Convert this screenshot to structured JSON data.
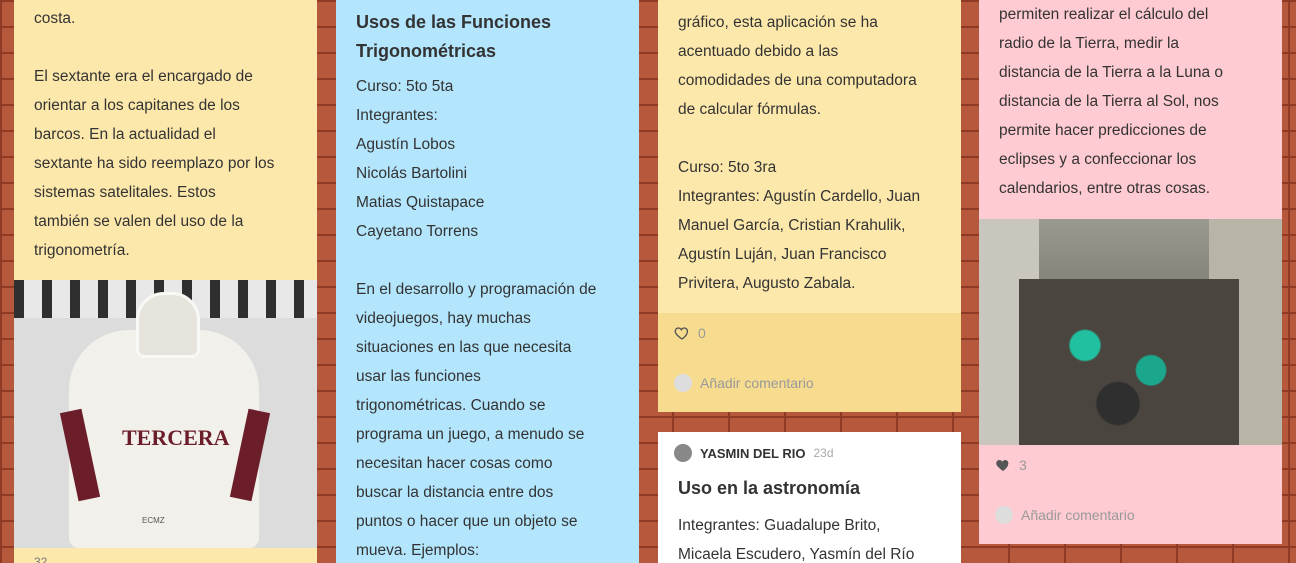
{
  "cards": {
    "c1": {
      "lines": [
        "costa.",
        "",
        "El sextante era el encargado de",
        "orientar a los capitanes de los",
        "barcos. En la actualidad el",
        "sextante ha sido reemplazo por los",
        "sistemas satelitales. Estos",
        "también se valen del uso de la",
        "trigonometría."
      ],
      "image_text": "TERCERA",
      "image_small_text": "ECMZ",
      "bottom_cut": "32"
    },
    "c2": {
      "title_l1": "Usos de las Funciones",
      "title_l2": "Trigonométricas",
      "lines": [
        "Curso: 5to 5ta",
        "Integrantes:",
        "Agustín Lobos",
        "Nicolás Bartolini",
        "Matias Quistapace",
        "Cayetano Torrens",
        "",
        "En el desarrollo y programación de",
        "videojuegos, hay muchas",
        "situaciones en las que necesita",
        "usar las funciones",
        "trigonométricas. Cuando se",
        "programa un juego, a menudo se",
        "necesitan hacer cosas como",
        "buscar la distancia entre dos",
        "puntos o hacer que un objeto se",
        "mueva.  Ejemplos:"
      ]
    },
    "c3": {
      "lines": [
        "gráfico, esta aplicación se ha",
        "acentuado debido a las",
        "comodidades de una computadora",
        "de calcular fórmulas.",
        "",
        "Curso: 5to 3ra",
        "Integrantes: Agustín Cardello, Juan",
        "Manuel García, Cristian Krahulik,",
        "Agustín Luján, Juan Francisco",
        "Privitera, Augusto Zabala."
      ],
      "likes": "0",
      "comment_placeholder": "Añadir comentario"
    },
    "c4": {
      "author": "YASMIN DEL RIO",
      "age": "23d",
      "title": "Uso en la astronomía",
      "lines": [
        "Integrantes: Guadalupe Brito,",
        "Micaela Escudero, Yasmín del Río"
      ]
    },
    "c5": {
      "lines": [
        "permiten realizar el cálculo del",
        "radio de la Tierra, medir la",
        "distancia de la Tierra a la Luna o",
        "distancia de la Tierra al Sol, nos",
        "permite hacer predicciones de",
        "eclipses y a  confeccionar los",
        "calendarios, entre otras cosas."
      ],
      "likes": "3",
      "comment_placeholder": "Añadir comentario"
    }
  },
  "colors": {
    "yellow": "#fde8ab",
    "blue": "#b3e5fc",
    "pink": "#ffcbd2",
    "white": "#ffffff",
    "brick": "#b6583b"
  },
  "icons": {
    "heart": "heart-icon",
    "comment_avatar": "user-avatar-icon"
  }
}
